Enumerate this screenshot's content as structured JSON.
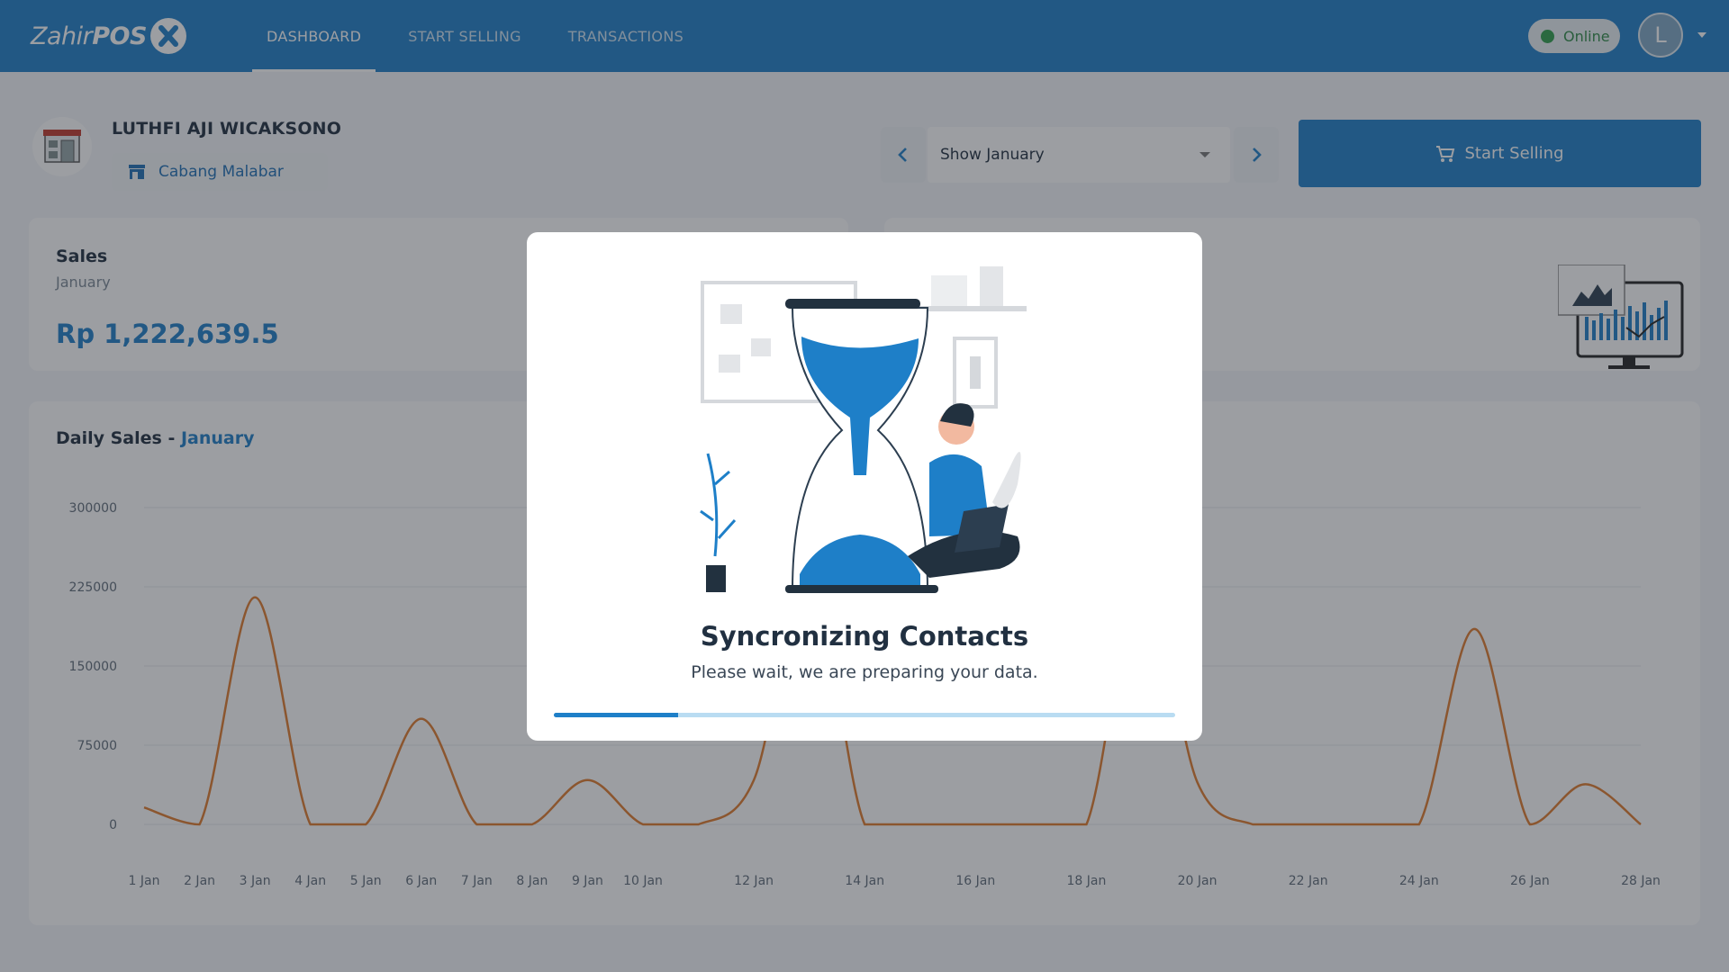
{
  "app": {
    "logo_text_a": "Zahir",
    "logo_text_b": "POS"
  },
  "nav": [
    {
      "label": "DASHBOARD",
      "active": true
    },
    {
      "label": "START SELLING",
      "active": false
    },
    {
      "label": "TRANSACTIONS",
      "active": false
    }
  ],
  "status": {
    "label": "Online",
    "color": "#2e9e4a"
  },
  "user": {
    "initial": "L",
    "name": "LUTHFI AJI WICAKSONO",
    "branch": "Cabang Malabar"
  },
  "month_select": {
    "value": "Show January"
  },
  "actions": {
    "start_selling": "Start Selling"
  },
  "sales_card": {
    "label": "Sales",
    "month": "January",
    "amount": "Rp 1,222,639.5"
  },
  "daily_sales": {
    "title": "Daily Sales - ",
    "month": "January"
  },
  "chart_data": {
    "type": "line",
    "categories": [
      "1 Jan",
      "2 Jan",
      "3 Jan",
      "4 Jan",
      "5 Jan",
      "6 Jan",
      "7 Jan",
      "8 Jan",
      "9 Jan",
      "10 Jan",
      "11 Jan",
      "12 Jan",
      "13 Jan",
      "14 Jan",
      "15 Jan",
      "16 Jan",
      "17 Jan",
      "18 Jan",
      "19 Jan",
      "20 Jan",
      "21 Jan",
      "22 Jan",
      "23 Jan",
      "24 Jan",
      "25 Jan",
      "26 Jan",
      "27 Jan",
      "28 Jan"
    ],
    "tick_labels": [
      "1 Jan",
      "2 Jan",
      "3 Jan",
      "4 Jan",
      "5 Jan",
      "6 Jan",
      "7 Jan",
      "8 Jan",
      "9 Jan",
      "10 Jan",
      "12 Jan",
      "14 Jan",
      "16 Jan",
      "18 Jan",
      "20 Jan",
      "22 Jan",
      "24 Jan",
      "26 Jan",
      "28 Jan"
    ],
    "values": [
      16000,
      0,
      215000,
      0,
      0,
      100000,
      0,
      0,
      42000,
      0,
      0,
      42000,
      240000,
      0,
      0,
      0,
      0,
      0,
      240000,
      40000,
      0,
      0,
      0,
      0,
      185000,
      0,
      38000,
      0
    ],
    "yticks": [
      0,
      75000,
      150000,
      225000,
      300000
    ],
    "ylim": [
      0,
      300000
    ],
    "line_color": "#e07b2c",
    "grid": true
  },
  "modal": {
    "title": "Syncronizing Contacts",
    "description": "Please wait, we are preparing your data.",
    "progress": 0.2
  },
  "colors": {
    "primary": "#1e7fc8"
  }
}
